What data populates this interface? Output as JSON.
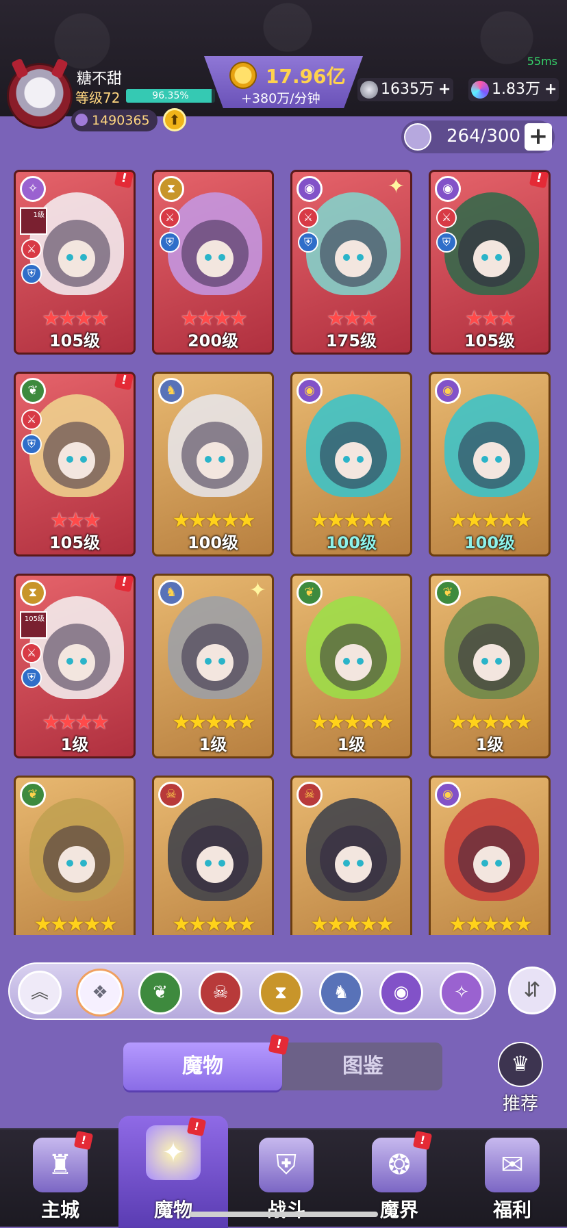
{
  "status": {
    "ping": "55ms"
  },
  "player": {
    "name": "糖不甜",
    "level_label": "等级72",
    "xp_percent": "96.35%",
    "xp_fraction": 0.9635,
    "power": "1490365",
    "upgrade_icon": "up-arrow-icon"
  },
  "currency": {
    "gold": "17.96亿",
    "gold_rate": "+380万/分钟",
    "silver": "1635万",
    "silver_plus": "+",
    "gems": "1.83万",
    "gems_plus": "+"
  },
  "capacity": {
    "count": "264/300",
    "add": "+"
  },
  "monsters": [
    {
      "level": "105级",
      "stars": "★★★★",
      "star_color": "red",
      "bg": "red",
      "faction": "✧",
      "faction_color": "#9a62d0",
      "mini_badge": "1级",
      "art": "#f4f2f6",
      "alert": "!"
    },
    {
      "level": "200级",
      "stars": "★★★★",
      "star_color": "red",
      "bg": "red",
      "faction": "⧗",
      "faction_color": "#c8952a",
      "art": "#c39ae8",
      "alert": ""
    },
    {
      "level": "175级",
      "stars": "★★★",
      "star_color": "red",
      "bg": "red",
      "faction": "◉",
      "faction_color": "#8252c8",
      "art": "#7fd8d0",
      "spark": "✦"
    },
    {
      "level": "105级",
      "stars": "★★★",
      "star_color": "red",
      "bg": "red",
      "faction": "◉",
      "faction_color": "#8252c8",
      "art": "#2d6a4a",
      "alert": "!"
    },
    {
      "level": "105级",
      "stars": "★★★",
      "star_color": "red",
      "bg": "red",
      "faction": "❦",
      "faction_color": "#3e8a3e",
      "art": "#f0d890",
      "alert": "!"
    },
    {
      "level": "100级",
      "stars": "★★★★★",
      "star_color": "yellow",
      "bg": "gold",
      "faction": "♞",
      "faction_color": "#5872b8",
      "art": "#e8e8ee"
    },
    {
      "level": "100级",
      "stars": "★★★★★",
      "star_color": "yellow",
      "bg": "gold",
      "faction": "◉",
      "faction_color": "#8252c8",
      "art": "#36c4cc",
      "cyan": true
    },
    {
      "level": "100级",
      "stars": "★★★★★",
      "star_color": "yellow",
      "bg": "gold",
      "faction": "◉",
      "faction_color": "#8252c8",
      "art": "#36c4cc",
      "cyan": true
    },
    {
      "level": "1级",
      "stars": "★★★★",
      "star_color": "red",
      "bg": "red",
      "faction": "⧗",
      "faction_color": "#c8952a",
      "mini_badge": "105级",
      "art": "#f5f5f5",
      "alert": "!"
    },
    {
      "level": "1级",
      "stars": "★★★★★",
      "star_color": "yellow",
      "bg": "gold",
      "faction": "♞",
      "faction_color": "#5872b8",
      "art": "#9aa0aa",
      "spark": "✦"
    },
    {
      "level": "1级",
      "stars": "★★★★★",
      "star_color": "yellow",
      "bg": "gold",
      "faction": "❦",
      "faction_color": "#3e8a3e",
      "art": "#9ae048"
    },
    {
      "level": "1级",
      "stars": "★★★★★",
      "star_color": "yellow",
      "bg": "gold",
      "faction": "❦",
      "faction_color": "#3e8a3e",
      "art": "#6a8a4a"
    },
    {
      "level": "",
      "stars": "★★★★★",
      "star_color": "yellow",
      "bg": "gold",
      "faction": "❦",
      "faction_color": "#3e8a3e",
      "art": "#c0a050"
    },
    {
      "level": "",
      "stars": "★★★★★",
      "star_color": "yellow",
      "bg": "gold",
      "faction": "☠",
      "faction_color": "#b83a3a",
      "art": "#3a3e4a"
    },
    {
      "level": "",
      "stars": "★★★★★",
      "star_color": "yellow",
      "bg": "gold",
      "faction": "☠",
      "faction_color": "#b83a3a",
      "art": "#3a3e4a"
    },
    {
      "level": "",
      "stars": "★★★★★",
      "star_color": "yellow",
      "bg": "gold",
      "faction": "◉",
      "faction_color": "#8252c8",
      "art": "#c83a3a"
    }
  ],
  "filters": [
    {
      "name": "collapse-up-icon",
      "glyph": "︽",
      "color": "#efeaf8",
      "text": "#555"
    },
    {
      "name": "all-factions-icon",
      "glyph": "❖",
      "color": "#f6f0ff",
      "text": "#6a6a7a"
    },
    {
      "name": "nature-faction-icon",
      "glyph": "❦",
      "color": "#3e8a3e",
      "text": "#fff"
    },
    {
      "name": "demon-faction-icon",
      "glyph": "☠",
      "color": "#b83a3a",
      "text": "#fff"
    },
    {
      "name": "time-faction-icon",
      "glyph": "⧗",
      "color": "#c8952a",
      "text": "#fff"
    },
    {
      "name": "dragon-faction-icon",
      "glyph": "♞",
      "color": "#5872b8",
      "text": "#fff"
    },
    {
      "name": "eye-faction-icon",
      "glyph": "◉",
      "color": "#8252c8",
      "text": "#fff"
    },
    {
      "name": "star-faction-icon",
      "glyph": "✧",
      "color": "#9a62d0",
      "text": "#fff"
    }
  ],
  "sort": {
    "icon": "sort-icon",
    "glyph": "⇵"
  },
  "tabs": {
    "monsters": "魔物",
    "codex": "图鉴",
    "alert": "!"
  },
  "recommend": {
    "label": "推荐",
    "glyph": "♛"
  },
  "nav": [
    {
      "label": "主城",
      "glyph": "♜",
      "alert": "!"
    },
    {
      "label": "魔物",
      "glyph": "✦",
      "alert": "!",
      "active": true
    },
    {
      "label": "战斗",
      "glyph": "⛨"
    },
    {
      "label": "魔界",
      "glyph": "❂",
      "alert": "!"
    },
    {
      "label": "福利",
      "glyph": "✉"
    }
  ]
}
